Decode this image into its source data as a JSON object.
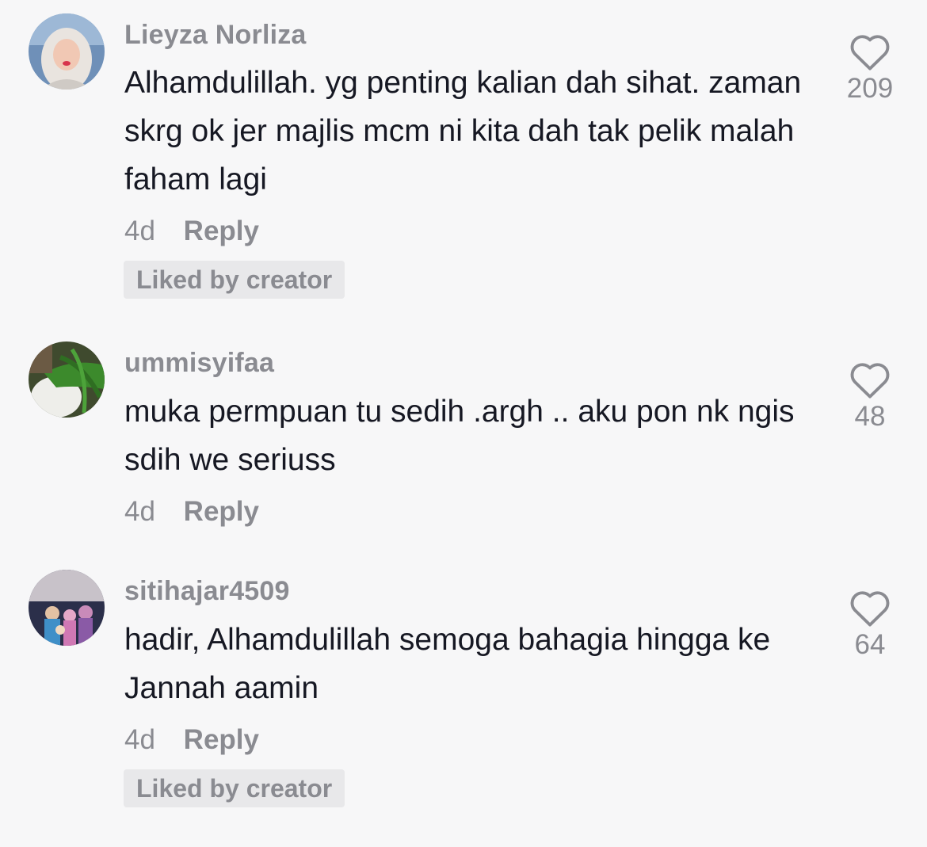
{
  "comments": [
    {
      "username": "Lieyza Norliza",
      "text": "Alhamdulillah. yg penting kalian dah sihat. zaman skrg ok jer majlis mcm ni kita dah tak pelik malah faham lagi",
      "time": "4d",
      "reply_label": "Reply",
      "liked_by_creator_label": "Liked by creator",
      "like_count": "209",
      "like_icon": "heart-outline-icon"
    },
    {
      "username": "ummisyifaa",
      "text": "muka permpuan tu sedih .argh .. aku pon nk ngis sdih we seriuss",
      "time": "4d",
      "reply_label": "Reply",
      "like_count": "48",
      "like_icon": "heart-outline-icon"
    },
    {
      "username": "sitihajar4509",
      "text": "hadir, Alhamdulillah semoga bahagia hingga ke Jannah aamin",
      "time": "4d",
      "reply_label": "Reply",
      "liked_by_creator_label": "Liked by creator",
      "like_count": "64",
      "like_icon": "heart-outline-icon"
    }
  ],
  "colors": {
    "background": "#f7f7f8",
    "text_primary": "#161823",
    "text_secondary": "#8a8b91",
    "badge_background": "#e8e8ea"
  }
}
